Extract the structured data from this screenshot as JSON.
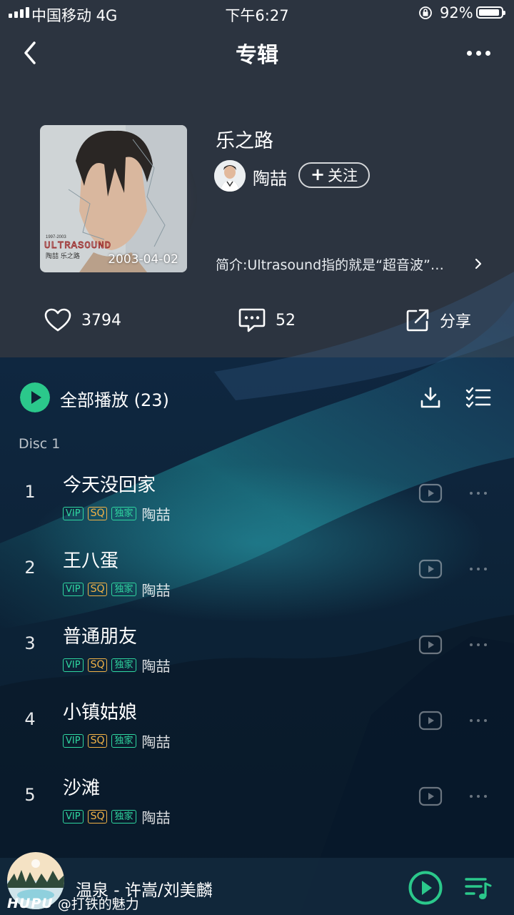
{
  "status_bar": {
    "carrier": "中国移动   4G",
    "time": "下午6:27",
    "battery": "92%",
    "battery_level": 0.92
  },
  "nav": {
    "title": "专辑"
  },
  "album": {
    "title": "乐之路",
    "release_date": "2003-04-02",
    "artist": "陶喆",
    "follow_label": "关注",
    "intro": "简介:Ultrasound指的就是“超音波”…",
    "cover_text": {
      "small": "1997-2003",
      "big": "ULTRASOUND",
      "caption": "陶喆 乐之路"
    }
  },
  "actions": {
    "likes": "3794",
    "comments": "52",
    "share": "分享"
  },
  "playlist": {
    "play_all": "全部播放 (23)",
    "disc": "Disc 1"
  },
  "tags": {
    "vip": "VIP",
    "sq": "SQ",
    "exclusive": "独家"
  },
  "songs": [
    {
      "index": "1",
      "title": "今天没回家",
      "artist": "陶喆"
    },
    {
      "index": "2",
      "title": "王八蛋",
      "artist": "陶喆"
    },
    {
      "index": "3",
      "title": "普通朋友",
      "artist": "陶喆"
    },
    {
      "index": "4",
      "title": "小镇姑娘",
      "artist": "陶喆"
    },
    {
      "index": "5",
      "title": "沙滩",
      "artist": "陶喆"
    }
  ],
  "player": {
    "now_playing": "温泉 - 许嵩/刘美麟"
  },
  "watermark": {
    "brand": "HUPU",
    "user": "@打铁的魅力"
  },
  "colors": {
    "accent": "#2bc88b",
    "header_bg": "#2c3440",
    "list_bg": "#0d2336"
  }
}
